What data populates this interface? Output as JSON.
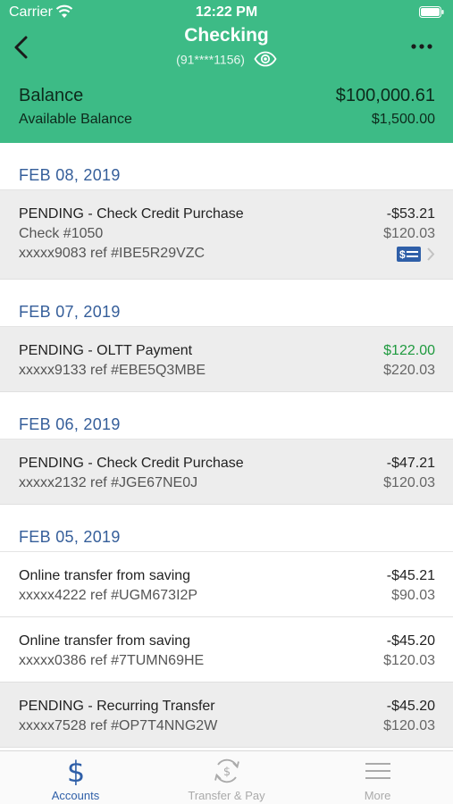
{
  "status_bar": {
    "carrier": "Carrier",
    "time": "12:22 PM"
  },
  "nav": {
    "title": "Checking",
    "account_mask": "(91****1156)"
  },
  "balance": {
    "label": "Balance",
    "value": "$100,000.61",
    "available_label": "Available Balance",
    "available_value": "$1,500.00"
  },
  "groups": [
    {
      "date": "FEB 08, 2019",
      "transactions": [
        {
          "title": "PENDING - Check Credit Purchase",
          "check": "Check #1050",
          "ref": "xxxxx9083 ref #IBE5R29VZC",
          "amount": "-$53.21",
          "balance": "$120.03",
          "pending": true
        }
      ]
    },
    {
      "date": "FEB 07, 2019",
      "transactions": [
        {
          "title": "PENDING - OLTT Payment",
          "ref": "xxxxx9133 ref #EBE5Q3MBE",
          "amount": "$122.00",
          "balance": "$220.03",
          "pending": true
        }
      ]
    },
    {
      "date": "FEB 06, 2019",
      "transactions": [
        {
          "title": "PENDING - Check Credit Purchase",
          "ref": "xxxxx2132 ref #JGE67NE0J",
          "amount": "-$47.21",
          "balance": "$120.03",
          "pending": true
        }
      ]
    },
    {
      "date": "FEB 05, 2019",
      "transactions": [
        {
          "title": "Online transfer from saving",
          "ref": "xxxxx4222 ref #UGM673I2P",
          "amount": "-$45.21",
          "balance": "$90.03",
          "pending": false
        },
        {
          "title": "Online transfer from saving",
          "ref": "xxxxx0386 ref #7TUMN69HE",
          "amount": "-$45.20",
          "balance": "$120.03",
          "pending": false
        },
        {
          "title": "PENDING - Recurring Transfer",
          "ref": "xxxxx7528 ref #OP7T4NNG2W",
          "amount": "-$45.20",
          "balance": "$120.03",
          "pending": true
        }
      ]
    }
  ],
  "tabs": [
    {
      "label": "Accounts",
      "icon": "dollar-icon",
      "active": true
    },
    {
      "label": "Transfer & Pay",
      "icon": "transfer-icon",
      "active": false
    },
    {
      "label": "More",
      "icon": "menu-icon",
      "active": false
    }
  ],
  "colors": {
    "header": "#3dbb86",
    "date": "#355e9a",
    "positive": "#1f9a3f",
    "tab_active": "#2f5fa8"
  }
}
